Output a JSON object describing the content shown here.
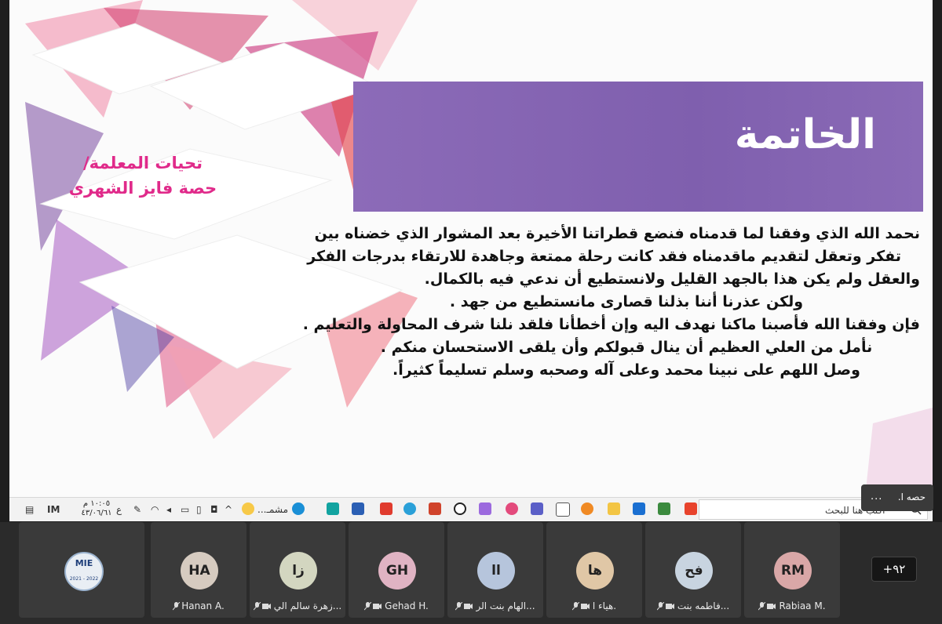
{
  "slide": {
    "title": "الخاتمة",
    "greeting_line1": "تحيات المعلمة/",
    "greeting_line2": "حصة فايز الشهري",
    "body": [
      "نحمد الله الذي وفقنا لما قدمناه فنضع قطراتنا الأخيرة بعد المشوار الذي خضناه بين",
      "تفكر وتعقل لتقديم ماقدمناه فقد كانت رحلة ممتعة وجاهدة للارتقاء بدرجات الفكر",
      "والعقل ولم يكن هذا بالجهد القليل ولانستطيع أن ندعي فيه بالكمال.",
      "ولكن عذرنا أننا بذلنا قصارى مانستطيع من جهد .",
      "فإن وفقنا الله فأصبنا ماكنا نهدف اليه وإن أخطأنا فلقد نلنا شرف المحاولة والتعليم .",
      "نأمل من العلي العظيم أن ينال قبولكم وأن يلقى الاستحسان منكم .",
      "وصل اللهم على نبينا محمد وعلى آله وصحبه وسلم تسليماً كثيراً."
    ],
    "colors": {
      "band": "#7f5fae",
      "greeting": "#e02a8a"
    }
  },
  "remote_taskbar": {
    "search_placeholder": "اكتب هنا للبحث",
    "time": "١٠:٠٥ م",
    "date": "٤٣/٠٦/٦١",
    "lang": "ع",
    "weather_label": "مشمـ..."
  },
  "presenter_tooltip": {
    "name": "حصه ا.",
    "more": "..."
  },
  "participants": [
    {
      "initials": "RM",
      "name": "Rabiaa M.",
      "avatar_color": "#d9a7a7"
    },
    {
      "initials": "فح",
      "name": "فاطمه بنت...",
      "avatar_color": "#c8d4e0"
    },
    {
      "initials": "ها",
      "name": "هياء ا.",
      "avatar_color": "#e0c7a6"
    },
    {
      "initials": "اا",
      "name": "الهام بنت الر...",
      "avatar_color": "#b6c5dc"
    },
    {
      "initials": "GH",
      "name": "Gehad H.",
      "avatar_color": "#e0b3c3"
    },
    {
      "initials": "زا",
      "name": "زهرة سالم الي...",
      "avatar_color": "#d3d6c0"
    },
    {
      "initials": "HA",
      "name": "Hanan A.",
      "avatar_color": "#d6cbc0"
    }
  ],
  "more_count": "+٩٢",
  "self_logo": {
    "text": "MIE",
    "sub": "2021 - 2022"
  }
}
